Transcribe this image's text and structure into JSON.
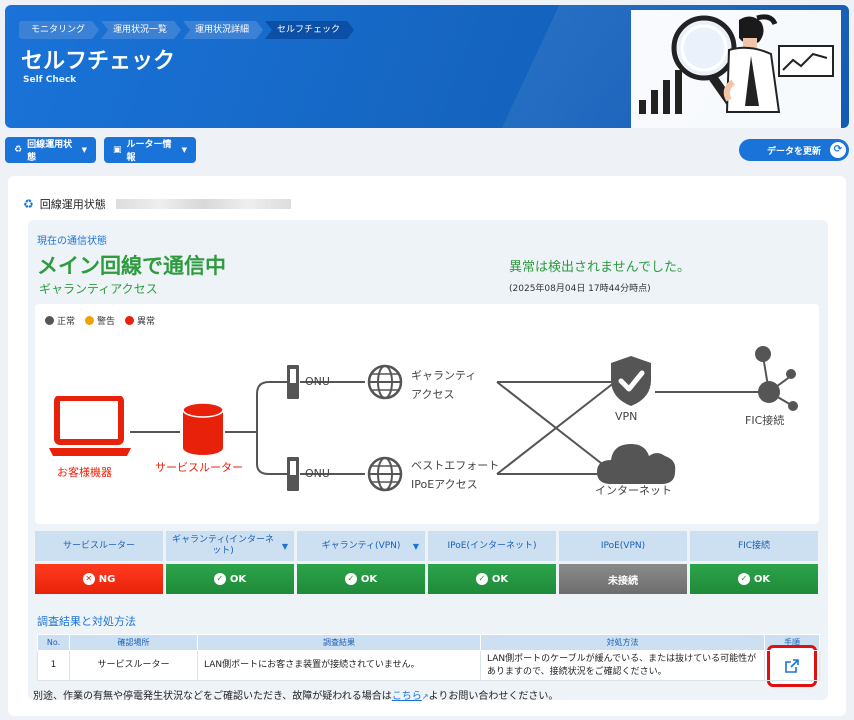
{
  "breadcrumb": [
    "モニタリング",
    "運用状況一覧",
    "運用状況詳細",
    "セルフチェック"
  ],
  "page": {
    "title": "セルフチェック",
    "subtitle": "Self Check"
  },
  "toolbar": {
    "line_status_label": "回線運用状態",
    "router_info_label": "ルーター情報",
    "refresh_label": "データを更新"
  },
  "section": {
    "title": "回線運用状態"
  },
  "status": {
    "current_label": "現在の通信状態",
    "main_message": "メイン回線で通信中",
    "sub_message": "ギャランティアクセス",
    "anomaly_message": "異常は検出されませんでした。",
    "timestamp": "(2025年08月04日 17時44分時点)"
  },
  "legend": [
    {
      "label": "正常",
      "color": "#555555"
    },
    {
      "label": "警告",
      "color": "#f0a000"
    },
    {
      "label": "異常",
      "color": "#e8220a"
    }
  ],
  "diagram": {
    "customer_device": "お客様機器",
    "service_router": "サービスルーター",
    "onu_1": "ONU",
    "onu_2": "ONU",
    "guarantee_line1": "ギャランティ",
    "guarantee_line2": "アクセス",
    "besteffort_line1": "ベストエフォート",
    "besteffort_line2": "IPoEアクセス",
    "vpn": "VPN",
    "internet": "インターネット",
    "fic": "FIC接続"
  },
  "status_table": {
    "headers": [
      "サービスルーター",
      "ギャランティ(インターネット)",
      "ギャランティ(VPN)",
      "IPoE(インターネット)",
      "IPoE(VPN)",
      "FIC接続"
    ],
    "values": [
      "NG",
      "OK",
      "OK",
      "OK",
      "未接続",
      "OK"
    ]
  },
  "investigation": {
    "title": "調査結果と対処方法",
    "headers": [
      "No.",
      "確認場所",
      "調査結果",
      "対処方法",
      "手順"
    ],
    "rows": [
      {
        "no": "1",
        "location": "サービスルーター",
        "result": "LAN側ポートにお客さま装置が接続されていません。",
        "action": "LAN側ポートのケーブルが緩んでいる、または抜けている可能性がありますので、接続状況をご確認ください。"
      }
    ]
  },
  "footnote": {
    "before": "別途、作業の有無や停電発生状況などをご確認いただき、故障が疑われる場合は",
    "link": "こちら",
    "after": "よりお問い合わせください。"
  }
}
